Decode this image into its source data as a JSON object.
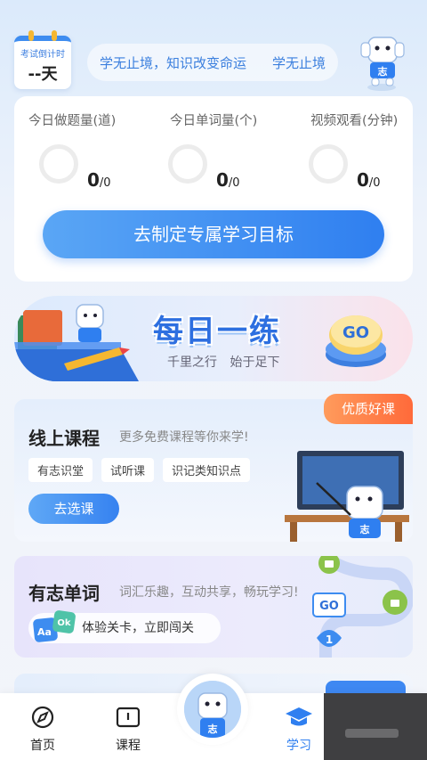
{
  "header": {
    "countdown_label": "考试倒计时",
    "countdown_value": "--天",
    "motto_left": "学无止境，知识改变命运",
    "motto_right": "学无止境"
  },
  "stats": [
    {
      "title": "今日做题量(道)",
      "value": "0",
      "total": "/0"
    },
    {
      "title": "今日单词量(个)",
      "value": "0",
      "total": "/0"
    },
    {
      "title": "视频观看(分钟)",
      "value": "0",
      "total": "/0"
    }
  ],
  "goal_button": "去制定专属学习目标",
  "daily_practice": {
    "headline": "每日一练",
    "subtitle": "千里之行 始于足下",
    "go_label": "GO"
  },
  "course": {
    "badge": "优质好课",
    "title": "线上课程",
    "desc": "更多免费课程等你来学!",
    "chips": [
      "有志识堂",
      "试听课",
      "识记类知识点"
    ],
    "button": "去选课"
  },
  "vocab": {
    "title": "有志单词",
    "desc": "词汇乐趣，互动共享，畅玩学习!",
    "pill": "体验关卡，立即闯关",
    "icon_text_a": "Aa",
    "icon_text_b": "Ok",
    "level_go": "GO",
    "level_num": "1"
  },
  "mascot_text": "志",
  "nav": {
    "items": [
      {
        "label": "首页",
        "icon": "home-icon"
      },
      {
        "label": "课程",
        "icon": "book-icon"
      },
      {
        "label": "学习",
        "icon": "graduation-cap-icon",
        "active": true
      }
    ]
  },
  "colors": {
    "accent": "#2f7ff0",
    "hot": "#ff6a3a"
  }
}
